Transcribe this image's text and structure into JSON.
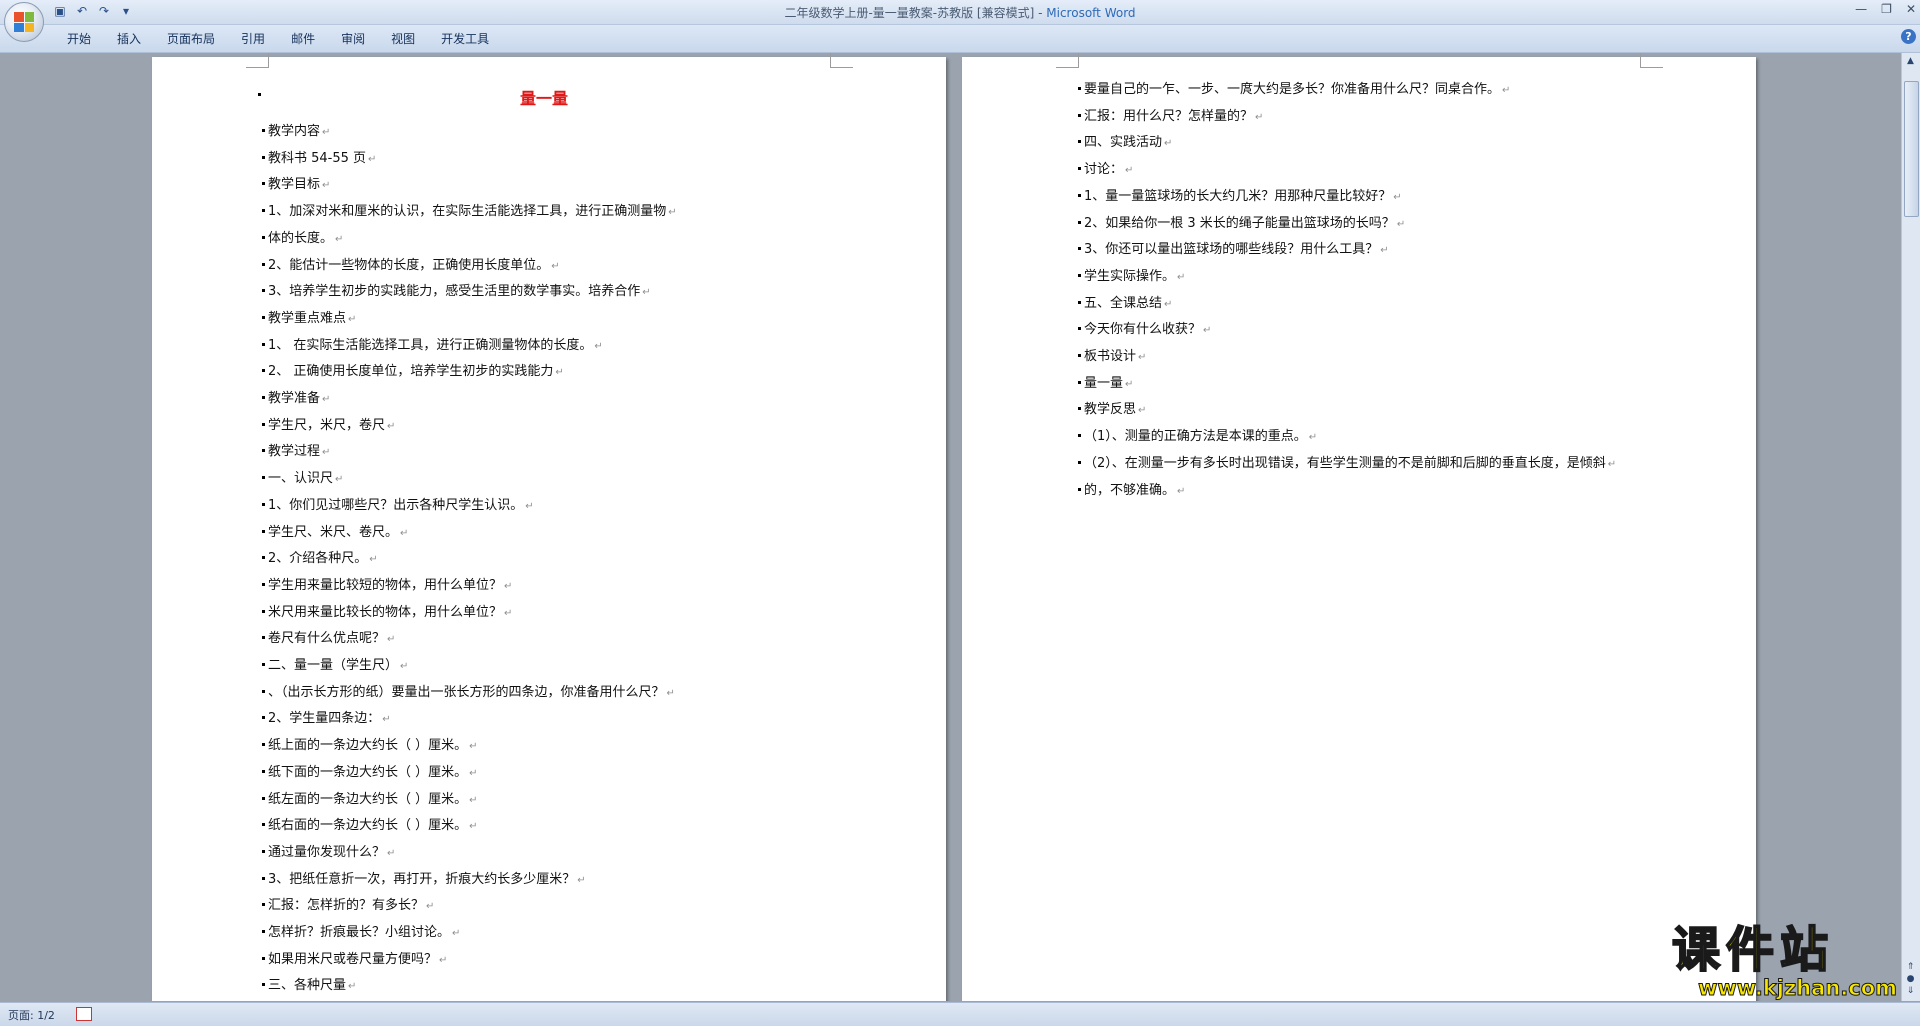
{
  "window": {
    "title_doc": "二年级数学上册-量一量教案-苏教版 [兼容模式]",
    "title_sep": " - ",
    "title_app": "Microsoft Word",
    "min": "—",
    "max": "❐",
    "close": "✕"
  },
  "qat": {
    "save": "▣",
    "undo": "↶",
    "redo": "↷",
    "more": "▾"
  },
  "ribbon": {
    "tabs": [
      "开始",
      "插入",
      "页面布局",
      "引用",
      "邮件",
      "审阅",
      "视图",
      "开发工具"
    ],
    "help": "?"
  },
  "page1": {
    "title": "量一量",
    "lines": [
      "教学内容",
      "教科书 54-55 页",
      "教学目标",
      "1、加深对米和厘米的认识，在实际生活能选择工具，进行正确测量物",
      "体的长度。",
      "2、能估计一些物体的长度，正确使用长度单位。",
      "3、培养学生初步的实践能力，感受生活里的数学事实。培养合作",
      "教学重点难点",
      "1、  在实际生活能选择工具，进行正确测量物体的长度。",
      "2、  正确使用长度单位，培养学生初步的实践能力",
      "教学准备",
      "学生尺，米尺，卷尺",
      "教学过程",
      "一、认识尺",
      "1、你们见过哪些尺？出示各种尺学生认识。",
      "学生尺、米尺、卷尺。",
      "2、介绍各种尺。",
      "学生用来量比较短的物体，用什么单位？",
      "米尺用来量比较长的物体，用什么单位？",
      "卷尺有什么优点呢？",
      "二、量一量（学生尺）",
      "、（出示长方形的纸）要量出一张长方形的四条边，你准备用什么尺？",
      "2、学生量四条边：",
      "      纸上面的一条边大约长（    ）厘米。",
      "纸下面的一条边大约长（    ）厘米。",
      "纸左面的一条边大约长（    ）厘米。",
      "纸右面的一条边大约长（    ）厘米。",
      "通过量你发现什么？",
      "3、把纸任意折一次，再打开，折痕大约长多少厘米？",
      "汇报：怎样折的？有多长？",
      "        怎样折？折痕最长？小组讨论。",
      "如果用米尺或卷尺量方便吗？",
      "三、各种尺量"
    ]
  },
  "page2": {
    "lines": [
      "要量自己的一乍、一步、一庹大约是多长？你准备用什么尺？同桌合作。",
      "汇报：用什么尺？怎样量的？",
      "四、实践活动",
      "讨论：",
      "1、量一量篮球场的长大约几米？用那种尺量比较好？",
      "2、如果给你一根 3 米长的绳子能量出篮球场的长吗？",
      "3、你还可以量出篮球场的哪些线段？用什么工具？",
      "学生实际操作。",
      "五、全课总结",
      "今天你有什么收获？",
      "板书设计",
      "量一量",
      "教学反思",
      "（1）、测量的正确方法是本课的重点。",
      "（2）、在测量一步有多长时出现错误，有些学生测量的不是前脚和后脚的垂直长度，是倾斜",
      "的，不够准确。"
    ]
  },
  "paragraph_mark": "↵",
  "status": {
    "page": "页面: 1/2"
  },
  "watermark": {
    "big": "课件站",
    "url": "www.kjzhan.com"
  },
  "colors": {
    "title_red": "#e01818",
    "watermark_yellow": "#f6e600",
    "ribbon_blue": "#c9d8ec"
  }
}
